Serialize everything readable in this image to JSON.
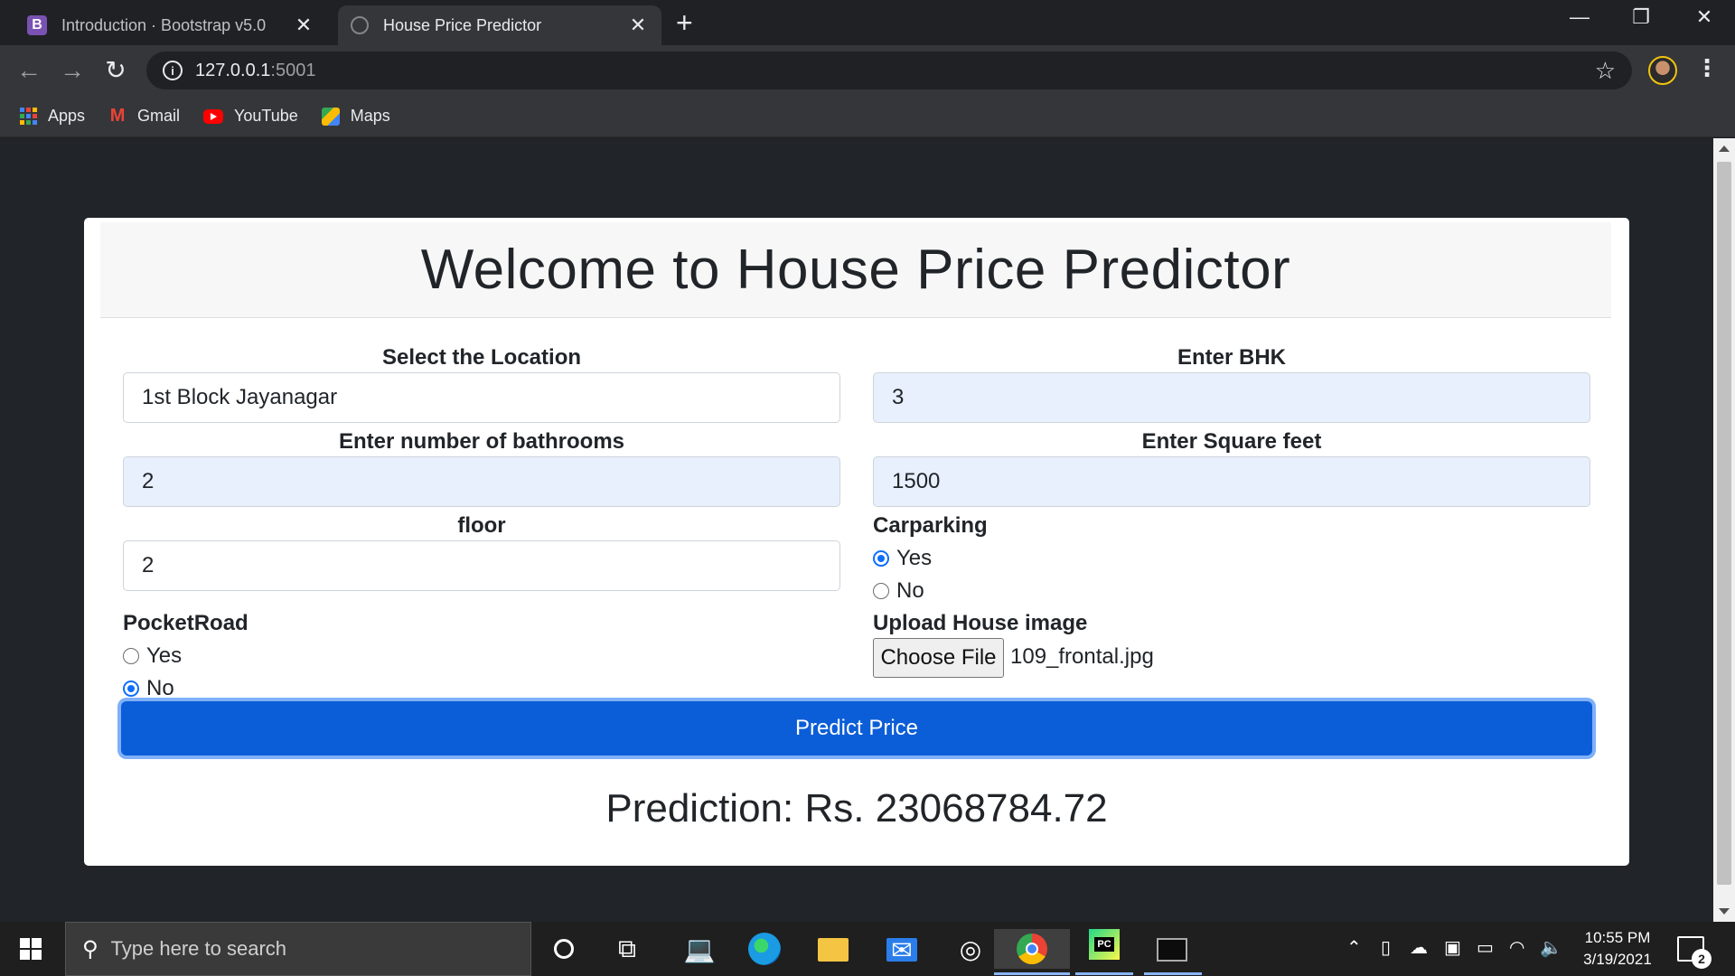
{
  "browser": {
    "tabs": [
      {
        "label": "Introduction · Bootstrap v5.0",
        "favicon": "bootstrap-icon",
        "favicon_text": "B"
      },
      {
        "label": "House Price Predictor",
        "favicon": "globe-icon",
        "active": true
      }
    ],
    "address": {
      "host": "127.0.0.1",
      "port": ":5001"
    },
    "bookmarks": [
      "Apps",
      "Gmail",
      "YouTube",
      "Maps"
    ]
  },
  "page": {
    "title": "Welcome to House Price Predictor",
    "location": {
      "label": "Select the Location",
      "value": "1st Block Jayanagar"
    },
    "bhk": {
      "label": "Enter BHK",
      "value": "3"
    },
    "bathrooms": {
      "label": "Enter number of bathrooms",
      "value": "2"
    },
    "sqft": {
      "label": "Enter Square feet",
      "value": "1500"
    },
    "floor": {
      "label": "floor",
      "value": "2"
    },
    "carparking": {
      "label": "Carparking",
      "options": [
        "Yes",
        "No"
      ],
      "selected": "Yes"
    },
    "pocketroad": {
      "label": "PocketRoad",
      "options": [
        "Yes",
        "No"
      ],
      "selected": "No"
    },
    "upload": {
      "label": "Upload House image",
      "button": "Choose File",
      "filename": "109_frontal.jpg"
    },
    "predict_button": "Predict Price",
    "prediction": "Prediction: Rs. 23068784.72"
  },
  "taskbar": {
    "search_placeholder": "Type here to search",
    "time": "10:55 PM",
    "date": "3/19/2021",
    "notification_count": "2"
  },
  "colors": {
    "primary": "#0b5ed7",
    "page_bg": "#212529",
    "autofill_bg": "#e8f0fe"
  }
}
